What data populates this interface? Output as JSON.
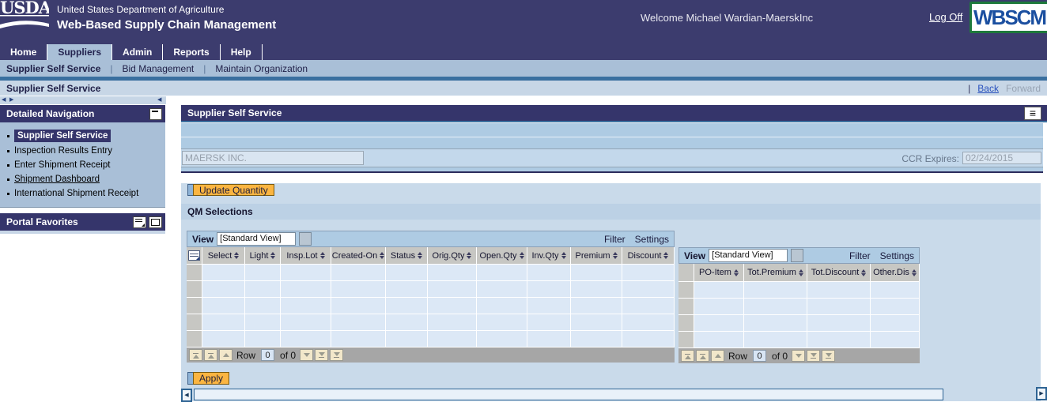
{
  "header": {
    "usda_logo": "USDA",
    "agency": "United States Department of Agriculture",
    "app_title": "Web-Based Supply Chain Management",
    "welcome": "Welcome Michael Wardian-MaerskInc",
    "log_off": "Log Off",
    "wbscm_logo": "WBSCM"
  },
  "tabs": [
    {
      "label": "Home"
    },
    {
      "label": "Suppliers",
      "active": true
    },
    {
      "label": "Admin"
    },
    {
      "label": "Reports"
    },
    {
      "label": "Help"
    }
  ],
  "subnav": {
    "separator": "|",
    "items": [
      {
        "label": "Supplier Self Service",
        "active": true
      },
      {
        "label": "Bid Management"
      },
      {
        "label": "Maintain Organization"
      }
    ]
  },
  "breadcrumb": {
    "title": "Supplier Self Service",
    "separator": "|",
    "back": "Back",
    "forward": "Forward"
  },
  "sidebar": {
    "detailed_navigation": {
      "title": "Detailed Navigation",
      "items": [
        {
          "label": "Supplier Self Service",
          "selected": true
        },
        {
          "label": "Inspection Results Entry"
        },
        {
          "label": "Enter Shipment Receipt"
        },
        {
          "label": "Shipment Dashboard",
          "underlined": true
        },
        {
          "label": "International Shipment Receipt"
        }
      ]
    },
    "portal_favorites": {
      "title": "Portal Favorites"
    }
  },
  "main": {
    "panel_title": "Supplier Self Service",
    "org_name": "MAERSK INC.",
    "ccr_label": "CCR Expires:",
    "ccr_value": "02/24/2015",
    "update_quantity_label": "Update Quantity",
    "qm_selections_title": "QM Selections",
    "apply_label": "Apply",
    "table1": {
      "view_label": "View",
      "view_value": "[Standard View]",
      "filter_label": "Filter",
      "settings_label": "Settings",
      "columns": [
        "Select",
        "Light",
        "Insp.Lot",
        "Created-On",
        "Status",
        "Orig.Qty",
        "Open.Qty",
        "Inv.Qty",
        "Premium",
        "Discount"
      ],
      "row_count": 5,
      "pager": {
        "row_label": "Row",
        "value": "0",
        "of_text": "of 0"
      }
    },
    "table2": {
      "view_label": "View",
      "view_value": "[Standard View]",
      "filter_label": "Filter",
      "settings_label": "Settings",
      "columns": [
        "PO-Item",
        "Tot.Premium",
        "Tot.Discount",
        "Other.Dis"
      ],
      "row_count": 4,
      "pager": {
        "row_label": "Row",
        "value": "0",
        "of_text": "of 0"
      }
    }
  },
  "icons": {
    "menu": "≡",
    "scroll_left": "◀",
    "scroll_right": "▶",
    "collapse_left": "◀"
  },
  "colors": {
    "header_navy": "#3C3C6E",
    "accent_blue": "#A9BFD7",
    "steel_blue": "#3A6F9F",
    "button_orange": "#FBB541",
    "content_blue": "#C9DAEA"
  }
}
